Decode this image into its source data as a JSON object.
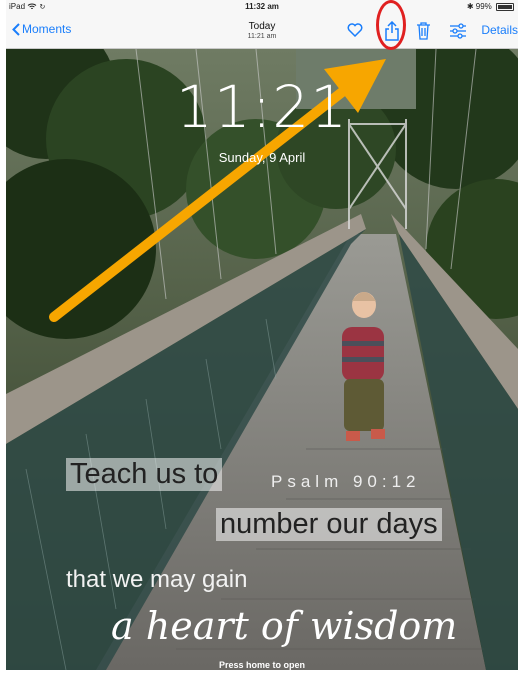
{
  "status_bar": {
    "device": "iPad",
    "time": "11:32 am",
    "battery": "99%"
  },
  "nav": {
    "back_label": "Moments",
    "title": "Today",
    "subtitle": "11:21 am",
    "details_label": "Details",
    "icons": [
      "heart-icon",
      "share-icon",
      "trash-icon",
      "adjust-icon"
    ]
  },
  "lock_screen": {
    "time": "11:21",
    "date": "Sunday, 9 April",
    "footer": "Press home to open"
  },
  "verse": {
    "line1": "Teach us to",
    "reference": "Psalm 90:12",
    "line2": "number our days",
    "line3": "that we may gain",
    "line4": "a heart of wisdom"
  },
  "colors": {
    "accent": "#1a7efb",
    "annotation_arrow": "#f7a600",
    "annotation_ring": "#e02020"
  }
}
